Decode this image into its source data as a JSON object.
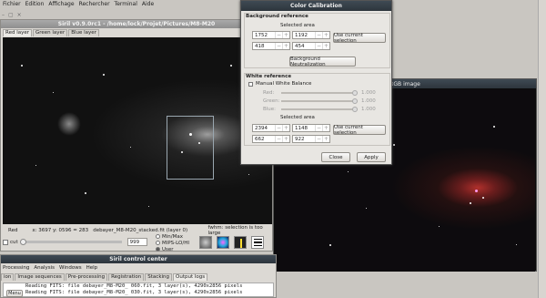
{
  "desktop": {
    "menu": [
      "Fichier",
      "Edition",
      "Affichage",
      "Rechercher",
      "Terminal",
      "Aide"
    ],
    "win_controls": [
      "–",
      "▢",
      "×"
    ]
  },
  "red_window": {
    "title": "Siril v0.9.0rc1 - /home/lock/Projet/Pictures/M8-M20",
    "tabs": [
      "Red layer",
      "Green layer",
      "Blue layer"
    ],
    "status": {
      "channel": "Red",
      "coords": "x: 3697 y: 0596 = 283",
      "file": "debayer_M8-M20_stacked.fit (layer 0)",
      "fwhm": "fwhm: selection is too large"
    },
    "cut_label": "cut",
    "cut_value": "999",
    "options": [
      {
        "label": "Min/Max",
        "checked": false
      },
      {
        "label": "MIPS-LO/HI",
        "checked": false
      },
      {
        "label": "User",
        "checked": true
      }
    ]
  },
  "rgb_window": {
    "title": "RGB image"
  },
  "calibration": {
    "title": "Color Calibration",
    "background_title": "Background reference",
    "background_area_label": "Selected area",
    "background_values": [
      "1752",
      "1192",
      "418",
      "454"
    ],
    "use_selection_label": "Use current selection",
    "neutralization_label": "Background Neutralization",
    "white_title": "White reference",
    "manual_wb_label": "Manual White Balance",
    "manual_wb_checked": false,
    "channels": [
      {
        "name": "Red:",
        "value": "1.000"
      },
      {
        "name": "Green:",
        "value": "1.000"
      },
      {
        "name": "Blue:",
        "value": "1.000"
      }
    ],
    "white_area_label": "Selected area",
    "white_values": [
      "2394",
      "1148",
      "662",
      "922"
    ],
    "close_label": "Close",
    "apply_label": "Apply"
  },
  "control": {
    "title": "Siril control center",
    "menu": [
      "Processing",
      "Analysis",
      "Windows",
      "Help"
    ],
    "tabs": [
      "ion",
      "Image sequences",
      "Pre-processing",
      "Registration",
      "Stacking",
      "Output logs"
    ],
    "active_tab": "Output logs",
    "logs": [
      "Reading FITS: file debayer_M8-M20_ 060.fit, 3 layer(s), 4290x2856 pixels",
      "Reading FITS: file debayer_M8-M20_ 030.fit, 3 layer(s), 4290x2856 pixels"
    ],
    "menu_button": "Menu"
  }
}
